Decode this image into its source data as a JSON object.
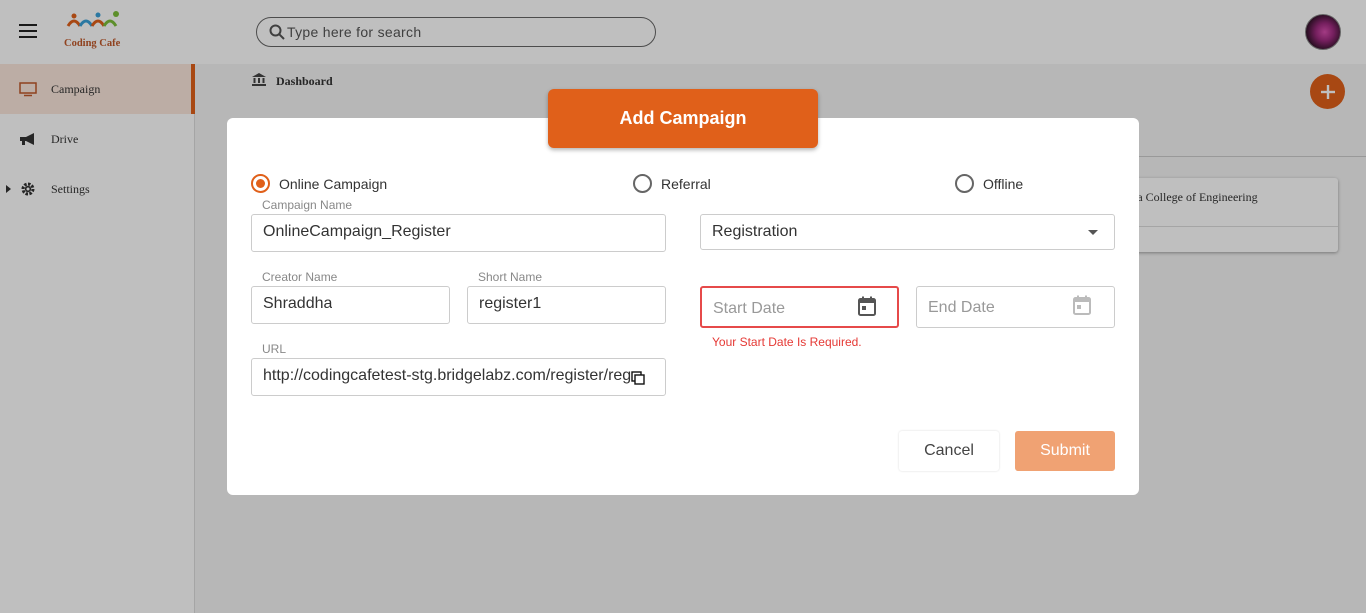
{
  "app": {
    "logo_text": "Coding Cafe"
  },
  "search": {
    "placeholder": "Type here for search"
  },
  "sidebar": {
    "items": [
      {
        "label": "Campaign"
      },
      {
        "label": "Drive"
      },
      {
        "label": "Settings"
      }
    ]
  },
  "breadcrumb": {
    "label": "Dashboard"
  },
  "background_card": {
    "text": "iya College of Engineering"
  },
  "modal": {
    "title": "Add Campaign",
    "campaign_types": {
      "online": "Online Campaign",
      "referral": "Referral",
      "offline": "Offline",
      "selected": "Online Campaign"
    },
    "campaign_name": {
      "label": "Campaign Name",
      "value": "OnlineCampaign_Register"
    },
    "category": {
      "value": "Registration"
    },
    "creator_name": {
      "label": "Creator Name",
      "value": "Shraddha"
    },
    "short_name": {
      "label": "Short Name",
      "value": "register1"
    },
    "start_date": {
      "placeholder": "Start Date",
      "error": "Your Start Date Is Required."
    },
    "end_date": {
      "placeholder": "End Date"
    },
    "url": {
      "label": "URL",
      "value": "http://codingcafetest-stg.bridgelabz.com/register/reg"
    },
    "cancel_label": "Cancel",
    "submit_label": "Submit"
  },
  "colors": {
    "accent": "#e0601a",
    "error": "#e53935",
    "submit_disabled": "#f0a273"
  },
  "icons": [
    "menu-icon",
    "search-icon",
    "monitor-icon",
    "megaphone-icon",
    "gear-icon",
    "bank-icon",
    "plus-icon",
    "calendar-icon",
    "copy-icon",
    "chevron-down-icon"
  ]
}
